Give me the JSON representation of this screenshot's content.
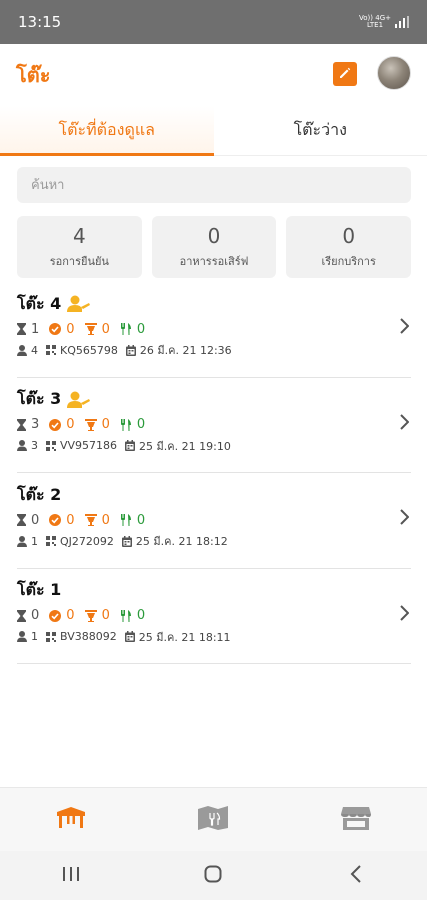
{
  "status_bar": {
    "time": "13:15",
    "network_top": "Vo)) 4G+",
    "network_bottom": "LTE1"
  },
  "app": {
    "title": "โต๊ะ",
    "brand_color": "#f07814"
  },
  "tabs": [
    {
      "label": "โต๊ะที่ต้องดูแล",
      "active": true
    },
    {
      "label": "โต๊ะว่าง",
      "active": false
    }
  ],
  "search": {
    "placeholder": "ค้นหา"
  },
  "stats": [
    {
      "value": "4",
      "label": "รอการยืนยัน"
    },
    {
      "value": "0",
      "label": "อาหารรอเสิร์ฟ"
    },
    {
      "value": "0",
      "label": "เรียกบริการ"
    }
  ],
  "tables": [
    {
      "name": "โต๊ะ 4",
      "has_waiter": true,
      "waiting": "1",
      "confirmed": "0",
      "service": "0",
      "served": "0",
      "guests": "4",
      "code": "KQ565798",
      "date": "26 มี.ค. 21 12:36"
    },
    {
      "name": "โต๊ะ 3",
      "has_waiter": true,
      "waiting": "3",
      "confirmed": "0",
      "service": "0",
      "served": "0",
      "guests": "3",
      "code": "VV957186",
      "date": "25 มี.ค. 21 19:10"
    },
    {
      "name": "โต๊ะ 2",
      "has_waiter": false,
      "waiting": "0",
      "confirmed": "0",
      "service": "0",
      "served": "0",
      "guests": "1",
      "code": "QJ272092",
      "date": "25 มี.ค. 21 18:12"
    },
    {
      "name": "โต๊ะ 1",
      "has_waiter": false,
      "waiting": "0",
      "confirmed": "0",
      "service": "0",
      "served": "0",
      "guests": "1",
      "code": "BV388092",
      "date": "25 มี.ค. 21 18:11"
    }
  ],
  "bottom_nav": [
    {
      "icon": "table-icon",
      "active": true
    },
    {
      "icon": "menu-book-icon",
      "active": false
    },
    {
      "icon": "store-icon",
      "active": false
    }
  ],
  "system_nav": [
    {
      "icon": "recent-apps-icon"
    },
    {
      "icon": "home-icon"
    },
    {
      "icon": "back-icon"
    }
  ]
}
